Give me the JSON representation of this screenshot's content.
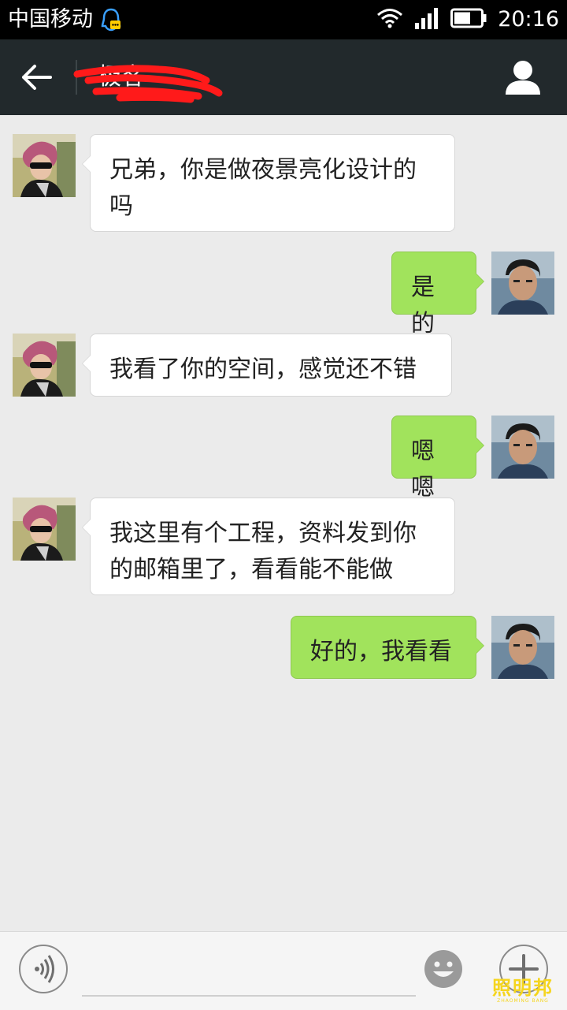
{
  "status_bar": {
    "carrier": "中国移动",
    "time": "20:16"
  },
  "header": {
    "title": "极客",
    "back_icon": "arrow-left-icon",
    "profile_icon": "person-icon"
  },
  "messages": [
    {
      "side": "in",
      "text": "兄弟，你是做夜景亮化设计的吗"
    },
    {
      "side": "out",
      "text": "是的"
    },
    {
      "side": "in",
      "text": "我看了你的空间，感觉还不错"
    },
    {
      "side": "out",
      "text": "嗯嗯"
    },
    {
      "side": "in",
      "text": "我这里有个工程，资料发到你的邮箱里了，看看能不能做"
    },
    {
      "side": "out",
      "text": "好的，我看看"
    }
  ],
  "input_bar": {
    "value": "",
    "placeholder": ""
  },
  "watermark": {
    "main": "照明邦",
    "sub": "ZHAOMING BANG"
  },
  "colors": {
    "incoming_bubble": "#ffffff",
    "outgoing_bubble": "#a1e35c",
    "header_bg": "#22292c",
    "chat_bg": "#ebebeb"
  }
}
